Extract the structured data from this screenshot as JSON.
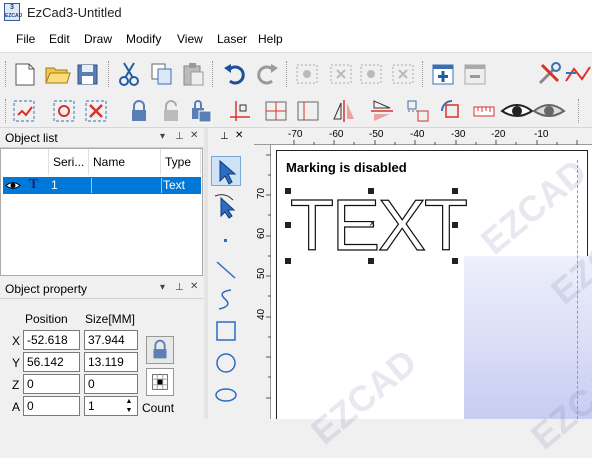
{
  "window": {
    "title": "EzCad3-Untitled",
    "icon_text": "3\nEZCAD"
  },
  "menu": {
    "items": [
      "File",
      "Edit",
      "Draw",
      "Modify",
      "View",
      "Laser",
      "Help"
    ]
  },
  "toolbar1": {
    "buttons": [
      "new-file-icon",
      "open-file-icon",
      "save-icon",
      "cut-icon",
      "copy-icon",
      "paste-icon",
      "undo-icon",
      "redo-icon",
      "group-icon",
      "ungroup-icon",
      "group-extend-icon",
      "group-shrink-icon",
      "add-document-icon",
      "remove-document-icon",
      "hatch-highlighted-icon",
      "tools-icon",
      "curve-tool-icon"
    ],
    "highlighted": "hatch-highlighted-icon"
  },
  "toolbar2": {
    "buttons": [
      "select-all-icon",
      "invert-select-icon",
      "cancel-select-icon",
      "lock-icon",
      "unlock-icon",
      "lock-all-icon",
      "node-edit-icon",
      "center-axis-icon",
      "cross-axis-icon",
      "mirror-h-icon",
      "mirror-v-icon",
      "align-icon",
      "rotate-icon",
      "eye-visible-icon",
      "eye-hidden-icon",
      "ruler-icon"
    ]
  },
  "object_list": {
    "title": "Object list",
    "columns": [
      "Seri...",
      "Name",
      "Type"
    ],
    "rows": [
      {
        "serial": "1",
        "name": "",
        "type": "Text",
        "visible_icon": "eye-icon",
        "type_icon": "text-T-icon"
      }
    ]
  },
  "object_property": {
    "title": "Object property",
    "headers": {
      "position": "Position",
      "size": "Size[MM]"
    },
    "rows": [
      {
        "label": "X",
        "position": "-52.618",
        "size": "37.944"
      },
      {
        "label": "Y",
        "position": "56.142",
        "size": "13.119"
      },
      {
        "label": "Z",
        "position": "0",
        "size": "0"
      },
      {
        "label": "A",
        "position": "0",
        "size": "1"
      }
    ],
    "count_label": "Count"
  },
  "canvas": {
    "message": "Marking is disabled",
    "text_object": "TEXT",
    "ruler_top": [
      "-70",
      "-60",
      "-50",
      "-40",
      "-30",
      "-20",
      "-10"
    ],
    "ruler_left": [
      "70",
      "60",
      "50",
      "40"
    ],
    "watermark": "EZCAD"
  },
  "colors": {
    "selection": "#0078d7",
    "highlight": "#e23b2e"
  }
}
